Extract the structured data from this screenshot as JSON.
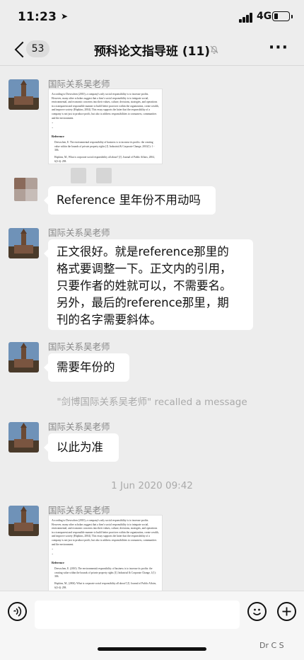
{
  "status_bar": {
    "time": "11:23",
    "network": "4G"
  },
  "nav": {
    "unread": "53",
    "title": "预科论文指导班 (11)"
  },
  "messages": [
    {
      "sender": "国际关系吴老师",
      "kind": "image"
    },
    {
      "sender": "",
      "kind": "text",
      "text": "Reference 里年份不用动吗"
    },
    {
      "sender": "国际关系吴老师",
      "kind": "text",
      "lines": [
        "正文很好。就是reference那里的",
        "格式要调整一下。正文内的引用，",
        "只要作者的姓就可以，不需要名。",
        "另外，最后的reference那里，期",
        "刊的名字需要斜体。"
      ]
    },
    {
      "sender": "国际关系吴老师",
      "kind": "text",
      "text": "需要年份的"
    },
    {
      "sender": "国际关系吴老师",
      "kind": "text",
      "text": "以此为准"
    },
    {
      "sender": "国际关系吴老师",
      "kind": "image"
    }
  ],
  "system": {
    "recalled": "\"剑博国际关系吴老师\" recalled a message",
    "timestamp": "1 Jun 2020 09:42"
  },
  "doc1": {
    "para": "According to Drewschen (2010), a company's only social responsibility is to increase profits. However, many other scholars suggest that a firm's social responsibility is to integrate social, environmental, and economic concerns into their values, culture, decisions, strategies, and operations in a transparent and responsible manner to build better practices within the organization, create wealth, and improve society (Hopkins, 2004). This essay supports the latter that the responsibility of a company is not just to produce profit, but also to address responsibilities to consumers, communities and the environment.",
    "ref": "Reference",
    "e1": "Drewschen, E. The environmental responsibility of business is to increase its profits: the creating value within the bounds of private property rights [J]. Industrial & Corporate Change, 2010(1): 1 - 306.",
    "e2": "Hopkins, M., What is corporate social responsibility all about? [J]. Journal of Public Affairs, 2004, 6(3-4): 298."
  },
  "doc2": {
    "para": "According to Drewschen (2010), a company's only social responsibility is to increase profits. However, many other scholars suggest that a firm's social responsibility is to integrate social, environmental, and economic concerns into their values, culture, decisions, strategies, and operations in a transparent and responsible manner to build better practices within the organization, create wealth, and improve society (Hopkins, 2004). This essay supports the latter that the responsibility of a company is not just to produce profit, but also to address responsibilities to consumers, communities and the environment.",
    "ref": "Reference",
    "e1": "Drewschen, E. (2010). The environmental responsibility of business is to increase its profits: the creating value within the bounds of private property rights [J]. Industrial & Corporate Change, 1(1): 306.",
    "e2": "Hopkins, M., (2004). What is corporate social responsibility all about? [J]. Journal of Public Affairs, 6(3-4): 298."
  },
  "watermark": "Dr C S",
  "colors": {
    "background": "#ededed",
    "bubble": "#ffffff",
    "accent_red": "#c0392b"
  }
}
